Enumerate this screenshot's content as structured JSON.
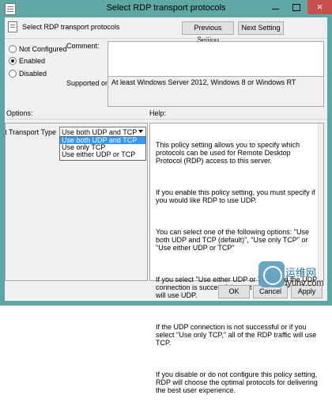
{
  "window": {
    "title": "Select RDP transport protocols",
    "close_label": "×"
  },
  "header": {
    "title": "Select RDP transport protocols",
    "previous_label": "Previous Setting",
    "next_label": "Next Setting"
  },
  "state": {
    "options": [
      {
        "label": "Not Configured",
        "checked": false
      },
      {
        "label": "Enabled",
        "checked": true
      },
      {
        "label": "Disabled",
        "checked": false
      }
    ]
  },
  "comment": {
    "label": "Comment:",
    "value": ""
  },
  "supported": {
    "label": "Supported on:",
    "value": "At least Windows Server 2012, Windows 8 or Windows RT"
  },
  "options_panel": {
    "label": "Options:",
    "transport_label": "Select Transport Type",
    "selected": "Use both UDP and TCP",
    "choices": [
      "Use both UDP and TCP",
      "Use only TCP",
      "Use either UDP or TCP"
    ]
  },
  "help_panel": {
    "label": "Help:",
    "paragraphs": [
      "This policy setting allows you to specify which protocols can be used for Remote Desktop Protocol (RDP) access to this server.",
      "If you enable this policy setting, you must specify if you would like RDP to use UDP.",
      "You can select one of the following options: \"Use both UDP and TCP (default)\", \"Use only TCP\" or \"Use either UDP or TCP\"",
      "If you select \"Use either UDP or TCP\" and the UDP connection is successful, most of the RDP traffic will use UDP.",
      "If the UDP connection is not successful or if you select \"Use only TCP,\" all of the RDP traffic will use TCP.",
      "If you disable or do not configure this policy setting, RDP will choose the optimal protocols for delivering the best user experience."
    ]
  },
  "footer": {
    "ok_label": "OK",
    "cancel_label": "Cancel",
    "apply_label": "Apply"
  },
  "watermark": {
    "title": "运维网",
    "site": "iyunv.com"
  }
}
